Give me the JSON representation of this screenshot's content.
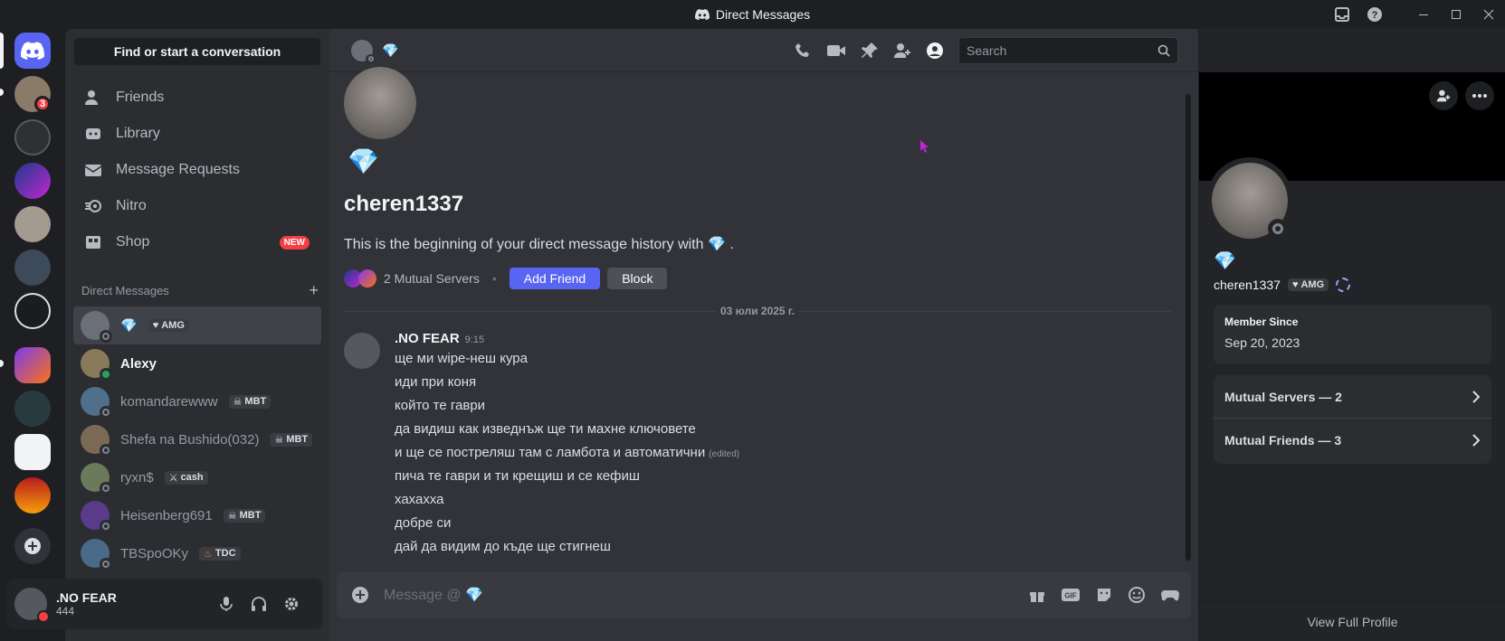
{
  "window": {
    "title": "Direct Messages",
    "accent": "#5865f2"
  },
  "servers": [
    {
      "name": "home",
      "badge": ""
    },
    {
      "name": "server-1",
      "badge": "3"
    },
    {
      "name": "server-2",
      "badge": ""
    },
    {
      "name": "server-3",
      "badge": ""
    },
    {
      "name": "server-4",
      "badge": ""
    },
    {
      "name": "server-5",
      "badge": ""
    },
    {
      "name": "server-6",
      "badge": ""
    },
    {
      "name": "server-7",
      "badge": ""
    },
    {
      "name": "server-8",
      "badge": ""
    },
    {
      "name": "server-9",
      "badge": ""
    },
    {
      "name": "server-10",
      "badge": ""
    }
  ],
  "sidebar": {
    "find_label": "Find or start a conversation",
    "nav": [
      {
        "label": "Friends",
        "icon": "friends-icon"
      },
      {
        "label": "Library",
        "icon": "library-icon"
      },
      {
        "label": "Message Requests",
        "icon": "envelope-icon"
      },
      {
        "label": "Nitro",
        "icon": "nitro-icon"
      },
      {
        "label": "Shop",
        "icon": "shop-icon",
        "badge": "NEW"
      }
    ],
    "dm_header": "Direct Messages",
    "dms": [
      {
        "name": "💎",
        "tag": "AMG",
        "tag_icon": "heart-icon",
        "status": "offline",
        "color": "#6b6f78"
      },
      {
        "name": "Alexy",
        "tag": "",
        "status": "online",
        "color": "#8a7a5c"
      },
      {
        "name": "komandarewww",
        "tag": "MBT",
        "tag_icon": "skull-icon",
        "status": "offline",
        "color": "#4f6f8a"
      },
      {
        "name": "Shefa na Bushido(032)",
        "tag": "MBT",
        "tag_icon": "skull-icon",
        "status": "offline",
        "color": "#7a6a55"
      },
      {
        "name": "ryxn$",
        "tag": "cash",
        "tag_icon": "sword-icon",
        "status": "offline",
        "color": "#6a7a5a"
      },
      {
        "name": "Heisenberg691",
        "tag": "MBT",
        "tag_icon": "skull-icon",
        "status": "offline",
        "color": "#5a3a8a"
      },
      {
        "name": "TBSpoOKy",
        "tag": "TDC",
        "tag_icon": "fire-icon",
        "status": "offline",
        "color": "#4a6a8a"
      }
    ]
  },
  "user": {
    "name": ".NO FEAR",
    "status": "444"
  },
  "chat": {
    "header_name": "💎",
    "search_placeholder": "Search",
    "intro_name": "cheren1337",
    "intro_text": "This is the beginning of your direct message history with",
    "intro_emoji": "💎",
    "mutual_servers": "2 Mutual Servers",
    "add_friend": "Add Friend",
    "block": "Block",
    "date_divider": "03 юли 2025 г.",
    "message": {
      "author": ".NO FEAR",
      "time": "9:15",
      "lines": [
        {
          "text": "ще ми wipe-неш кура",
          "edited": ""
        },
        {
          "text": "иди при коня",
          "edited": ""
        },
        {
          "text": "който те гаври",
          "edited": ""
        },
        {
          "text": "да видиш как изведнъж ще ти махне ключовете",
          "edited": ""
        },
        {
          "text": "и ще се постреляш там с ламбота и автоматични",
          "edited": "(edited)"
        },
        {
          "text": "пича те гаври и ти крещиш и се кефиш",
          "edited": ""
        },
        {
          "text": "хахахха",
          "edited": ""
        },
        {
          "text": "добре си",
          "edited": ""
        },
        {
          "text": "дай да видим до къде ще стигнеш",
          "edited": ""
        }
      ]
    },
    "composer_placeholder": "Message @"
  },
  "profile": {
    "emoji": "💎",
    "username": "cheren1337",
    "tag": "AMG",
    "member_since_label": "Member Since",
    "member_since": "Sep 20, 2023",
    "mutual_servers": "Mutual Servers — 2",
    "mutual_friends": "Mutual Friends — 3",
    "view_full": "View Full Profile"
  }
}
